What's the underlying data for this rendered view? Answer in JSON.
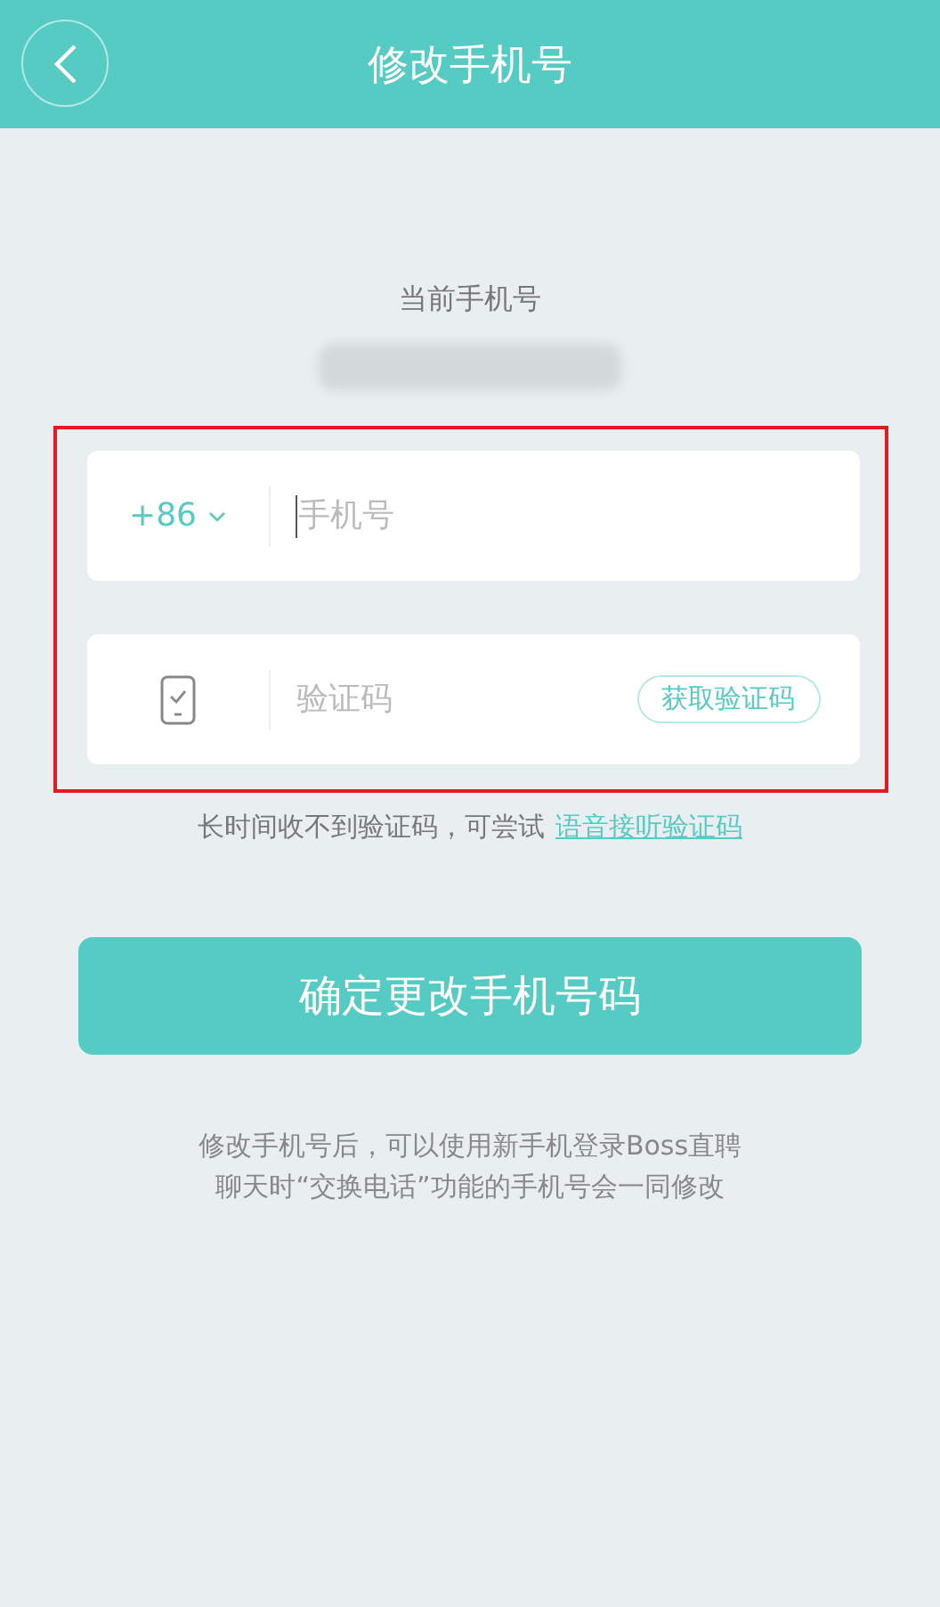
{
  "header": {
    "title": "修改手机号"
  },
  "current_phone": {
    "label": "当前手机号"
  },
  "form": {
    "country_code": "+86",
    "phone_placeholder": "手机号",
    "code_placeholder": "验证码",
    "get_code_button": "获取验证码"
  },
  "hint": {
    "text": "长时间收不到验证码，可尝试",
    "link": "语音接听验证码"
  },
  "submit_button": "确定更改手机号码",
  "notes": [
    "修改手机号后，可以使用新手机登录Boss直聘",
    "聊天时“交换电话”功能的手机号会一同修改"
  ]
}
